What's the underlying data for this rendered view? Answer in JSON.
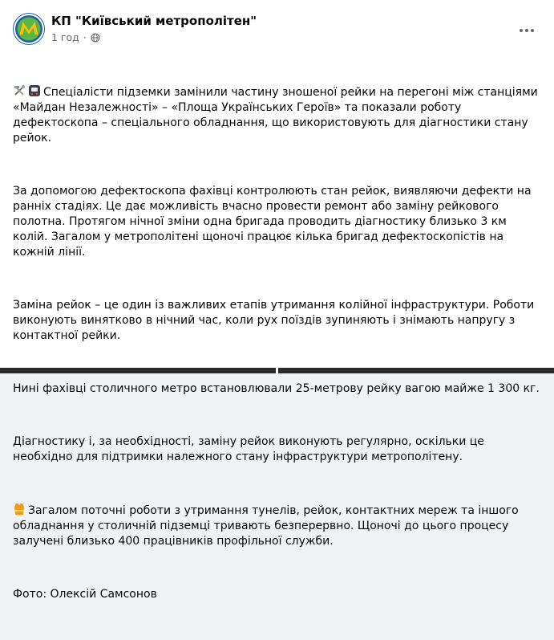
{
  "post": {
    "page_name": "КП \"Київський метрополітен\"",
    "time": "1 год",
    "separator": "·",
    "icons": {
      "avatar": "kyiv-metro-logo-icon",
      "privacy": "globe-icon",
      "more": "more-horizontal-icon"
    },
    "paragraphs": [
      "Спеціалісти підземки замінили частину зношеної рейки на перегоні між станціями «Майдан Незалежності» – «Площа Українських Героїв» та показали роботу дефектоскопа – спеціального обладнання, що використовують для діагностики стану рейок.",
      "За допомогою дефектоскопа фахівці контролюють стан рейок, виявляючи дефекти на ранніх стадіях. Це дає можливість вчасно провести ремонт або заміну рейкового полотна. Протягом нічної зміни одна бригада проводить діагностику близько 3 км колій. Загалом у метрополітені щоночі працює кілька бригад дефектоскопістів на кожній лінії.",
      "Заміна рейок – це один із важливих етапів утримання колійної інфраструктури. Роботи виконують винятково в нічний час, коли рух поїздів зупиняють і знімають напругу з контактної рейки.",
      "Нині фахівці столичного метро встановлювали 25-метрову рейку вагою майже 1 300 кг.",
      "Діагностику і, за необхідності, заміну рейок виконують регулярно, оскільки це необхідно для підтримки належного стану інфраструктури метрополітену.",
      "Загалом поточні роботи з утримання тунелів, рейок, контактних мереж та іншого обладнання у столичній підземці тривають безперервно. Щоночі до цього процесу залучені близько 400 працівників профільної служби.",
      "Фото: Олексій Самсонов"
    ],
    "emoji_icons": {
      "p0_first": "hammer-and-wrench-icon",
      "p0_second": "metro-icon",
      "p5_first": "safety-vest-icon"
    },
    "colors": {
      "brand_green": "#58b548",
      "brand_blue": "#1f5fa8",
      "brand_yellow": "#f2c10b",
      "meta_gray": "#65676b",
      "vest_orange": "#f39c12"
    }
  }
}
